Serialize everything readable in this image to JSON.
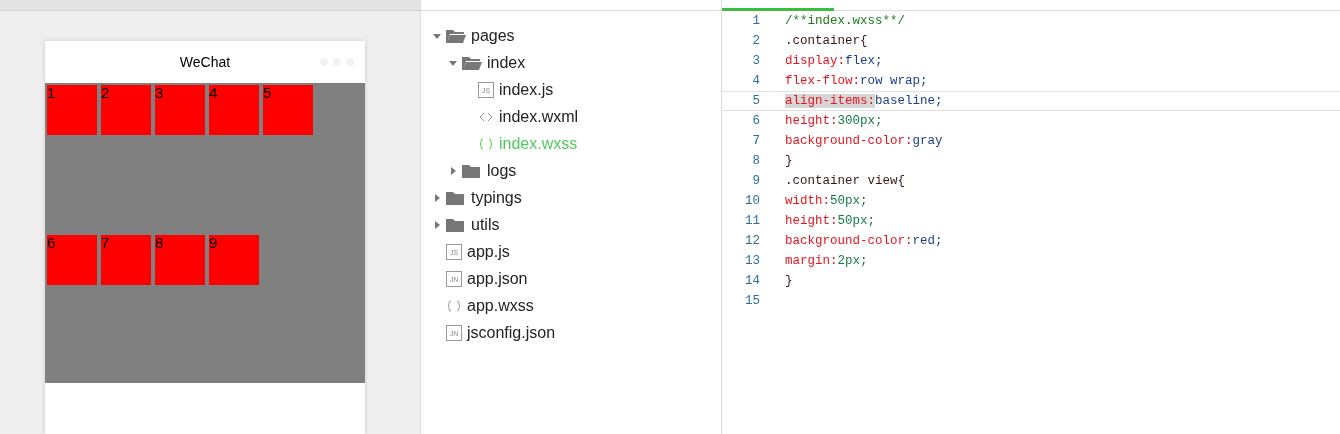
{
  "simulator": {
    "nav_title": "WeChat",
    "boxes": [
      {
        "label": "1"
      },
      {
        "label": "2"
      },
      {
        "label": "3"
      },
      {
        "label": "4"
      },
      {
        "label": "5"
      },
      {
        "label": "6"
      },
      {
        "label": "7"
      },
      {
        "label": "8"
      },
      {
        "label": "9"
      }
    ]
  },
  "file_tree": [
    {
      "name": "pages",
      "kind": "folder",
      "expanded": true,
      "children": [
        {
          "name": "index",
          "kind": "folder",
          "expanded": true,
          "children": [
            {
              "name": "index.js",
              "kind": "js",
              "icon_text": "JS",
              "selected": false
            },
            {
              "name": "index.wxml",
              "kind": "wxml",
              "selected": false
            },
            {
              "name": "index.wxss",
              "kind": "wxss",
              "selected": true
            }
          ]
        },
        {
          "name": "logs",
          "kind": "folder",
          "expanded": false
        }
      ]
    },
    {
      "name": "typings",
      "kind": "folder",
      "expanded": false
    },
    {
      "name": "utils",
      "kind": "folder",
      "expanded": false
    },
    {
      "name": "app.js",
      "kind": "js",
      "icon_text": "JS",
      "selected": false
    },
    {
      "name": "app.json",
      "kind": "json",
      "icon_text": "JN",
      "selected": false
    },
    {
      "name": "app.wxss",
      "kind": "wxss",
      "selected": false
    },
    {
      "name": "jsconfig.json",
      "kind": "json",
      "icon_text": "JN",
      "selected": false
    }
  ],
  "editor": {
    "lines": [
      {
        "number": "1",
        "selected": false,
        "tokens": [
          {
            "text": "/**index.wxss**/",
            "kind": "comment"
          }
        ]
      },
      {
        "number": "2",
        "selected": false,
        "tokens": [
          {
            "text": ".container{",
            "kind": "selector"
          }
        ]
      },
      {
        "number": "3",
        "selected": false,
        "tokens": [
          {
            "text": "display:",
            "kind": "property"
          },
          {
            "text": "flex;",
            "kind": "value"
          }
        ]
      },
      {
        "number": "4",
        "selected": false,
        "tokens": [
          {
            "text": "flex-flow:",
            "kind": "property"
          },
          {
            "text": "row wrap;",
            "kind": "value"
          }
        ]
      },
      {
        "number": "5",
        "selected": true,
        "tokens": [
          {
            "text": "align-items:",
            "kind": "property"
          },
          {
            "text": "baseline;",
            "kind": "value"
          }
        ]
      },
      {
        "number": "6",
        "selected": false,
        "tokens": [
          {
            "text": "height:",
            "kind": "property"
          },
          {
            "text": "300px;",
            "kind": "number"
          }
        ]
      },
      {
        "number": "7",
        "selected": false,
        "tokens": [
          {
            "text": "background-color:",
            "kind": "property"
          },
          {
            "text": "gray",
            "kind": "value"
          }
        ]
      },
      {
        "number": "8",
        "selected": false,
        "tokens": [
          {
            "text": "}",
            "kind": "selector"
          }
        ]
      },
      {
        "number": "9",
        "selected": false,
        "tokens": [
          {
            "text": ".container view{",
            "kind": "selector"
          }
        ]
      },
      {
        "number": "10",
        "selected": false,
        "tokens": [
          {
            "text": "width:",
            "kind": "property"
          },
          {
            "text": "50px;",
            "kind": "number"
          }
        ]
      },
      {
        "number": "11",
        "selected": false,
        "tokens": [
          {
            "text": "height:",
            "kind": "property"
          },
          {
            "text": "50px;",
            "kind": "number"
          }
        ]
      },
      {
        "number": "12",
        "selected": false,
        "tokens": [
          {
            "text": "background-color:",
            "kind": "property"
          },
          {
            "text": "red;",
            "kind": "value"
          }
        ]
      },
      {
        "number": "13",
        "selected": false,
        "tokens": [
          {
            "text": "margin:",
            "kind": "property"
          },
          {
            "text": "2px;",
            "kind": "number"
          }
        ]
      },
      {
        "number": "14",
        "selected": false,
        "tokens": [
          {
            "text": "}",
            "kind": "selector"
          }
        ]
      },
      {
        "number": "15",
        "selected": false
      }
    ]
  }
}
